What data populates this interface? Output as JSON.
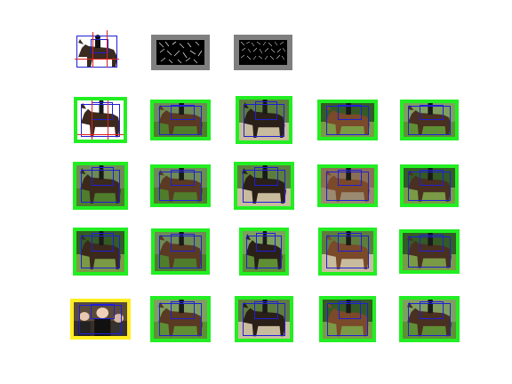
{
  "figure": {
    "background": "#ffffff",
    "true_positive_color": "#22ee22",
    "false_positive_color": "#ffee22",
    "detection_box_color": "#1f1fd6",
    "part_box_color": "#e02020"
  },
  "model": {
    "root_view": "horse-rider-icon",
    "root_filter": "hog-root-filter-icon",
    "part_filters": "hog-part-filters-icon"
  },
  "detections": [
    [
      {
        "label": "tp",
        "scene": "white"
      },
      {
        "label": "tp",
        "scene": "grass"
      },
      {
        "label": "tp",
        "scene": "arena"
      },
      {
        "label": "tp",
        "scene": "trees"
      },
      {
        "label": "tp",
        "scene": "field"
      }
    ],
    [
      {
        "label": "tp",
        "scene": "grass"
      },
      {
        "label": "tp",
        "scene": "grass"
      },
      {
        "label": "tp",
        "scene": "arena"
      },
      {
        "label": "tp",
        "scene": "building"
      },
      {
        "label": "tp",
        "scene": "trees"
      }
    ],
    [
      {
        "label": "tp",
        "scene": "trees"
      },
      {
        "label": "tp",
        "scene": "grass"
      },
      {
        "label": "tp",
        "scene": "field"
      },
      {
        "label": "tp",
        "scene": "arena"
      },
      {
        "label": "tp",
        "scene": "trees"
      }
    ],
    [
      {
        "label": "fp",
        "scene": "crowd"
      },
      {
        "label": "tp",
        "scene": "field"
      },
      {
        "label": "tp",
        "scene": "arena"
      },
      {
        "label": "tp",
        "scene": "trees"
      },
      {
        "label": "tp",
        "scene": "field"
      }
    ]
  ]
}
